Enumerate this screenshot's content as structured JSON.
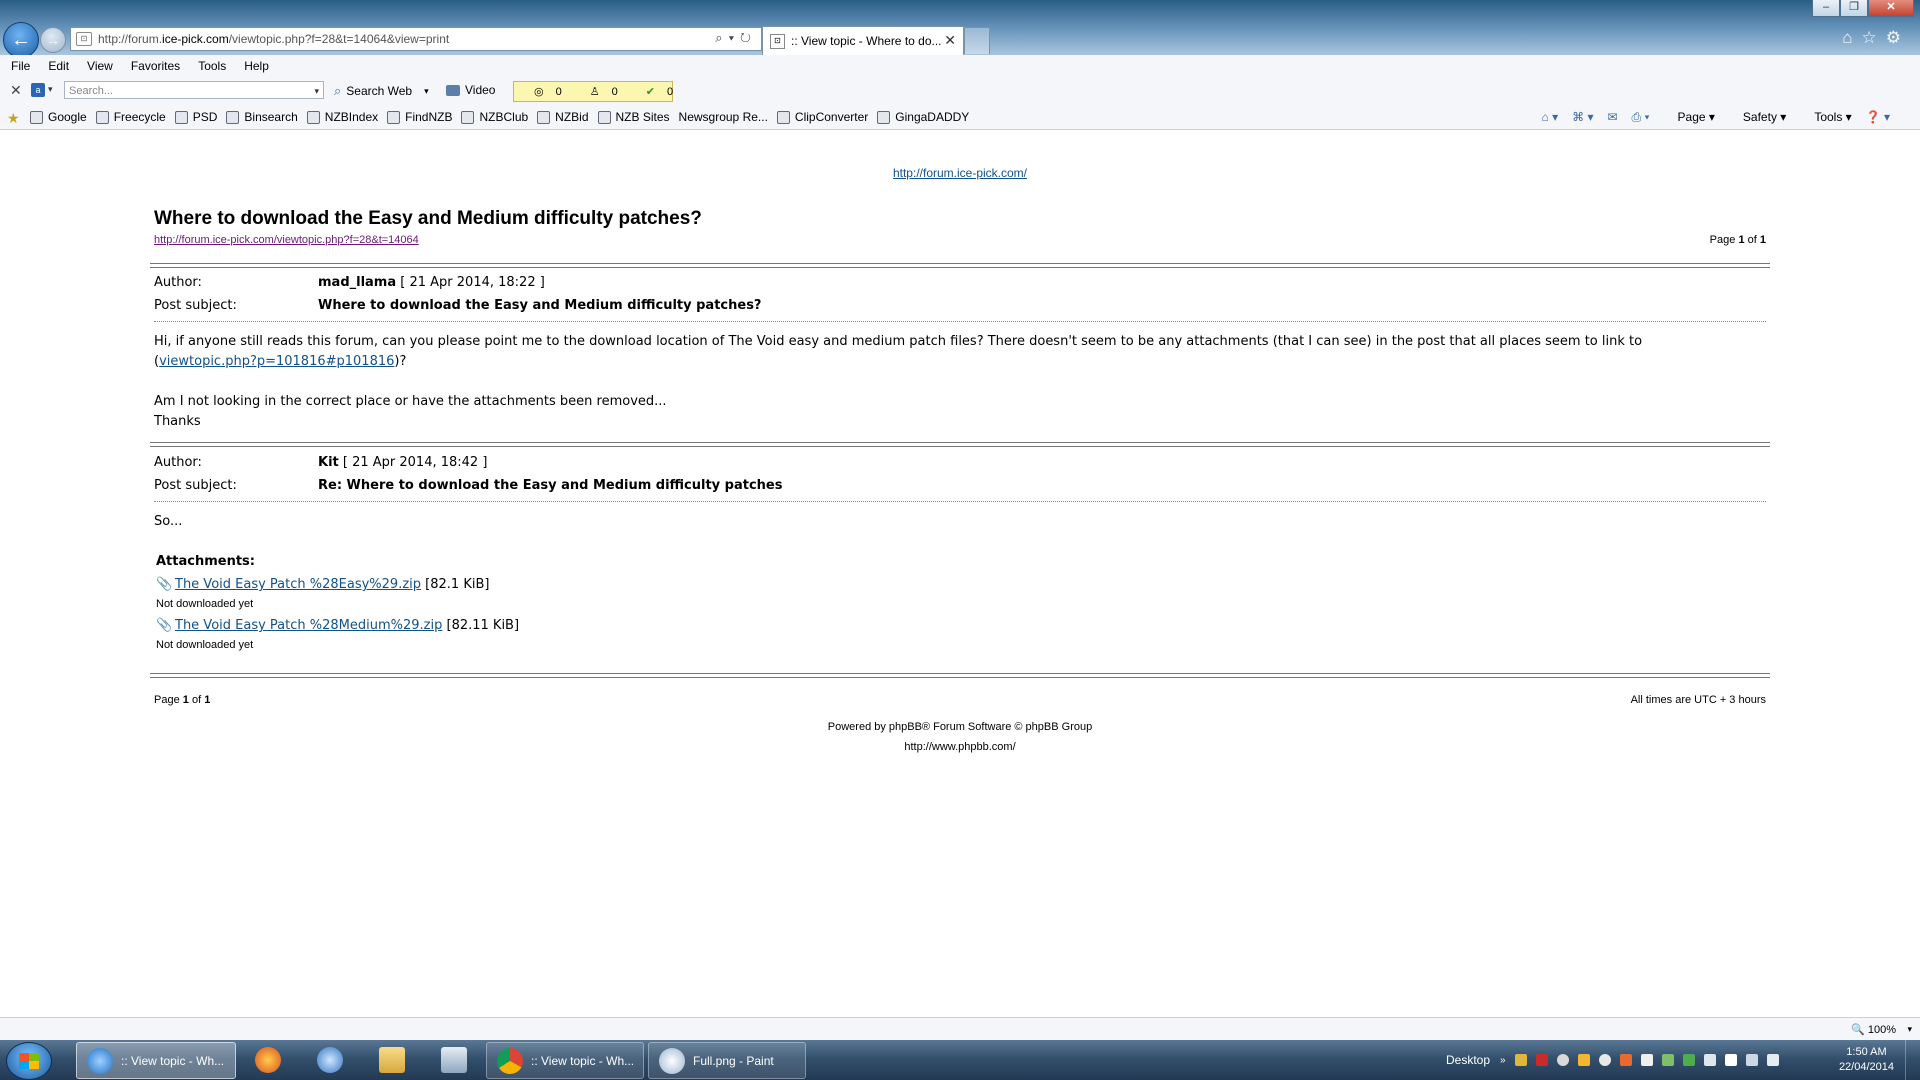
{
  "browser": {
    "url_prefix": "http://forum.",
    "url_domain": "ice-pick.com",
    "url_suffix": "/viewtopic.php?f=28&t=14064&view=print",
    "tab_title": ":: View topic - Where to do...",
    "menu": [
      "File",
      "Edit",
      "View",
      "Favorites",
      "Tools",
      "Help"
    ],
    "search_placeholder": "Search...",
    "search_web_label": "Search Web",
    "video_label": "Video",
    "counters": [
      "0",
      "0",
      "0"
    ],
    "favorites": [
      "Google",
      "Freecycle",
      "PSD",
      "Binsearch",
      "NZBIndex",
      "FindNZB",
      "NZBClub",
      "NZBid",
      "NZB Sites",
      "Newsgroup Re...",
      "ClipConverter",
      "GingaDADDY"
    ],
    "command_menu": {
      "page": "Page",
      "safety": "Safety",
      "tools": "Tools"
    },
    "zoom": "100%"
  },
  "page": {
    "site_link": "http://forum.ice-pick.com/",
    "topic_title": "Where to download the Easy and Medium difficulty patches?",
    "topic_url": "http://forum.ice-pick.com/viewtopic.php?f=28&t=14064",
    "page_label": "Page",
    "page_current": "1",
    "page_of": "of",
    "page_total": "1",
    "author_label": "Author:",
    "subject_label": "Post subject:",
    "posts": [
      {
        "author": "mad_llama",
        "date": "[ 21 Apr 2014, 18:22 ]",
        "subject": "Where to download the Easy and Medium difficulty patches?",
        "body_line1": "Hi, if anyone still reads this forum, can you please point me to the download location of The Void easy and medium patch files? There doesn't seem to be any attachments (that I can see) in the post that all places seem to link to",
        "body_link_open": "(",
        "body_link": "viewtopic.php?p=101816#p101816",
        "body_link_close": ")?",
        "body_line3": "Am I not looking in the correct place or have the attachments been removed...",
        "body_line4": "Thanks"
      },
      {
        "author": "Kit",
        "date": "[ 21 Apr 2014, 18:42 ]",
        "subject": "Re: Where to download the Easy and Medium difficulty patches",
        "body": "So...",
        "attachments_label": "Attachments:",
        "attachments": [
          {
            "name": "The Void Easy Patch %28Easy%29.zip",
            "size": "[82.1 KiB]",
            "status": "Not downloaded yet"
          },
          {
            "name": "The Void Easy Patch %28Medium%29.zip",
            "size": "[82.11 KiB]",
            "status": "Not downloaded yet"
          }
        ]
      }
    ],
    "timezone": "All times are UTC + 3 hours",
    "powered_by": "Powered by phpBB® Forum Software © phpBB Group",
    "phpbb_url": "http://www.phpbb.com/"
  },
  "taskbar": {
    "items": [
      ":: View topic - Wh...",
      ":: View topic - Wh...",
      "Full.png - Paint"
    ],
    "desktop_label": "Desktop",
    "time": "1:50 AM",
    "date": "22/04/2014"
  }
}
